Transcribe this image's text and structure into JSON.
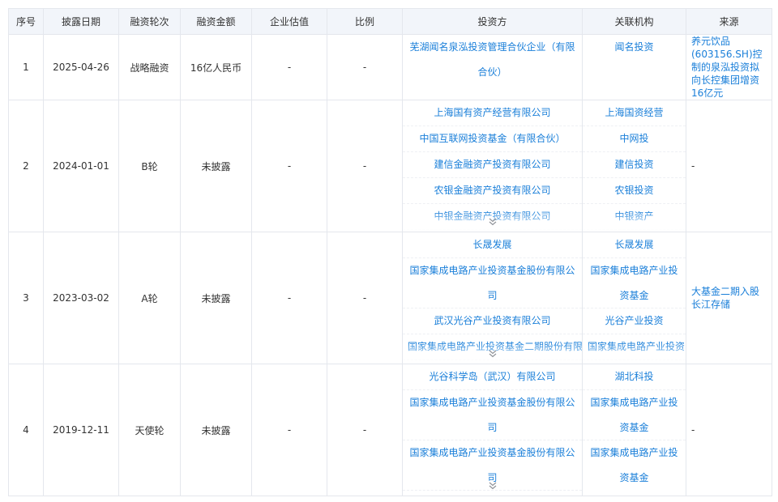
{
  "headers": [
    "序号",
    "披露日期",
    "融资轮次",
    "融资金额",
    "企业估值",
    "比例",
    "投资方",
    "关联机构",
    "来源"
  ],
  "rows": [
    {
      "idx": "1",
      "date": "2025-04-26",
      "round": "战略融资",
      "amount": "16亿人民币",
      "valuation": "-",
      "ratio": "-",
      "investors": [
        "芜湖闻名泉泓投资管理合伙企业（有限合伙）"
      ],
      "orgs": [
        "闻名投资"
      ],
      "source": "养元饮品(603156.SH)控制的泉泓投资拟向长控集团增资16亿元",
      "collapsed": false
    },
    {
      "idx": "2",
      "date": "2024-01-01",
      "round": "B轮",
      "amount": "未披露",
      "valuation": "-",
      "ratio": "-",
      "investors": [
        "上海国有资产经营有限公司",
        "中国互联网投资基金（有限合伙）",
        "建信金融资产投资有限公司",
        "农银金融资产投资有限公司",
        "中银金融资产投资有限公司"
      ],
      "orgs": [
        "上海国资经营",
        "中网投",
        "建信投资",
        "农银投资",
        "中银资产"
      ],
      "source": "-",
      "collapsed": true
    },
    {
      "idx": "3",
      "date": "2023-03-02",
      "round": "A轮",
      "amount": "未披露",
      "valuation": "-",
      "ratio": "-",
      "investors": [
        "长晟发展",
        "国家集成电路产业投资基金股份有限公司",
        "武汉光谷产业投资有限公司",
        "国家集成电路产业投资基金二期股份有限公司"
      ],
      "orgs": [
        "长晟发展",
        "国家集成电路产业投资基金",
        "光谷产业投资",
        "国家集成电路产业投资"
      ],
      "source": "大基金二期入股长江存储",
      "collapsed": true
    },
    {
      "idx": "4",
      "date": "2019-12-11",
      "round": "天使轮",
      "amount": "未披露",
      "valuation": "-",
      "ratio": "-",
      "investors": [
        "光谷科学岛（武汉）有限公司",
        "国家集成电路产业投资基金股份有限公司",
        "国家集成电路产业投资基金股份有限公司"
      ],
      "orgs": [
        "湖北科投",
        "国家集成电路产业投资基金",
        "国家集成电路产业投资基金"
      ],
      "source": "-",
      "collapsed": true
    }
  ],
  "icons": {
    "expand": "chevron-double-down-icon"
  },
  "colors": {
    "link": "#1a7fd9",
    "header_bg": "#f2f5fa",
    "border": "#e4e7ed"
  }
}
